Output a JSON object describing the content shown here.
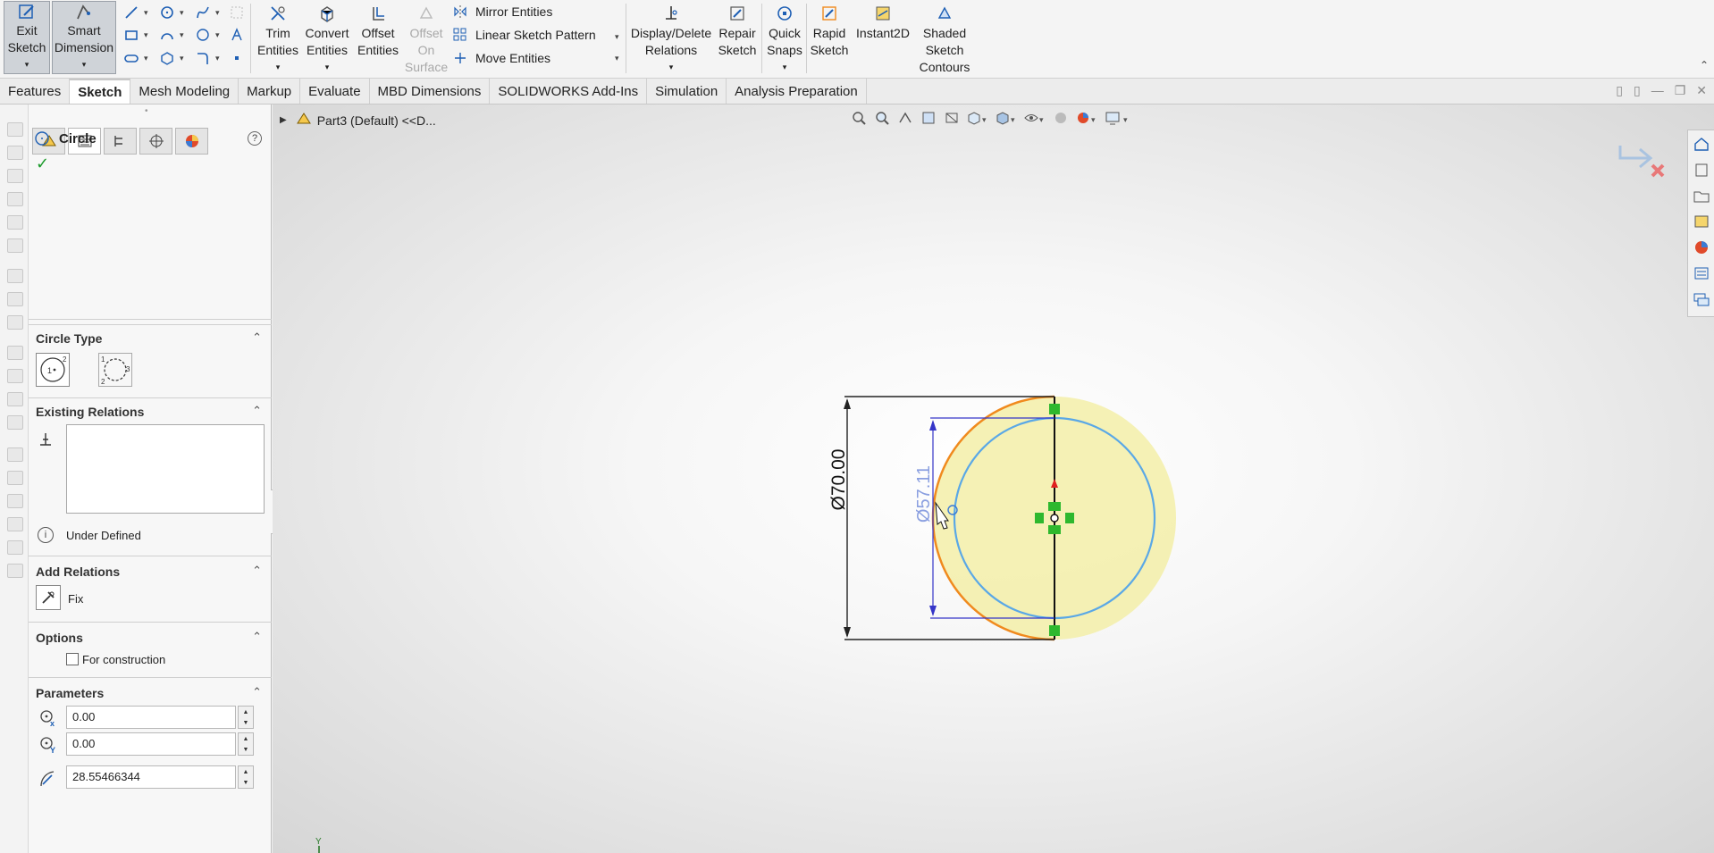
{
  "ribbon": {
    "exit_sketch": [
      "Exit",
      "Sketch"
    ],
    "smart_dimension": [
      "Smart",
      "Dimension"
    ],
    "trim_entities": [
      "Trim",
      "Entities"
    ],
    "convert_entities": [
      "Convert",
      "Entities"
    ],
    "offset_entities": [
      "Offset",
      "Entities"
    ],
    "offset_on_surface": [
      "Offset",
      "On",
      "Surface"
    ],
    "mirror_entities": "Mirror Entities",
    "linear_sketch_pattern": "Linear Sketch Pattern",
    "move_entities": "Move Entities",
    "display_delete_relations": [
      "Display/Delete",
      "Relations"
    ],
    "repair_sketch": [
      "Repair",
      "Sketch"
    ],
    "quick_snaps": [
      "Quick",
      "Snaps"
    ],
    "rapid_sketch": [
      "Rapid",
      "Sketch"
    ],
    "instant2d": "Instant2D",
    "shaded_sketch_contours": [
      "Shaded",
      "Sketch",
      "Contours"
    ]
  },
  "tabs": [
    {
      "label": "Features",
      "active": false
    },
    {
      "label": "Sketch",
      "active": true
    },
    {
      "label": "Mesh Modeling",
      "active": false
    },
    {
      "label": "Markup",
      "active": false
    },
    {
      "label": "Evaluate",
      "active": false
    },
    {
      "label": "MBD Dimensions",
      "active": false
    },
    {
      "label": "SOLIDWORKS Add-Ins",
      "active": false
    },
    {
      "label": "Simulation",
      "active": false
    },
    {
      "label": "Analysis Preparation",
      "active": false
    }
  ],
  "property_manager": {
    "title": "Circle",
    "circle_type": {
      "title": "Circle Type",
      "options": [
        "center-circle",
        "perimeter-circle"
      ]
    },
    "existing_relations": {
      "title": "Existing Relations",
      "status": "Under Defined"
    },
    "add_relations": {
      "title": "Add Relations",
      "fix_label": "Fix"
    },
    "options": {
      "title": "Options",
      "for_construction_label": "For construction",
      "for_construction_checked": false
    },
    "parameters": {
      "title": "Parameters",
      "cx": "0.00",
      "cy": "0.00",
      "radius": "28.55466344"
    }
  },
  "viewport": {
    "tree_label": "Part3 (Default) <<D...",
    "dimension_outer": "Ø70.00",
    "dimension_inner": "Ø57.11",
    "axis_label": "Y"
  },
  "colors": {
    "accent_blue": "#1e5fb4",
    "sketch_blue": "#5aa8e6",
    "preview_orange": "#f08a1e",
    "dim_dark": "#222222",
    "dim_blue": "#3535c8",
    "fill_yellow": "#f3efa8"
  }
}
